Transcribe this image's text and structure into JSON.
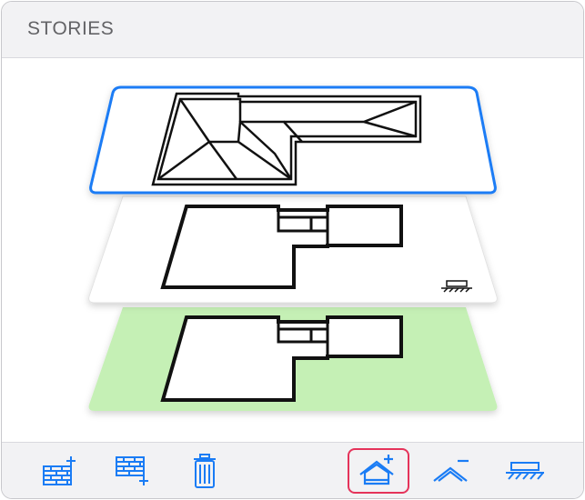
{
  "panel": {
    "title": "STORIES"
  },
  "stories": [
    {
      "name": "roof",
      "selected": true,
      "border_color": "#1a7cf5"
    },
    {
      "name": "upper-floor",
      "selected": false
    },
    {
      "name": "ground-floor",
      "selected": false,
      "fill_color": "#c5f0b5"
    }
  ],
  "toolbar": {
    "buttons": [
      {
        "name": "add-story-above-button",
        "icon": "brick-wall-plus-icon"
      },
      {
        "name": "add-story-below-button",
        "icon": "brick-wall-plus-below-icon"
      },
      {
        "name": "delete-story-button",
        "icon": "trash-icon"
      },
      {
        "name": "add-roof-button",
        "icon": "house-plus-icon",
        "active": true
      },
      {
        "name": "remove-roof-button",
        "icon": "roof-minus-icon"
      },
      {
        "name": "foundation-button",
        "icon": "ground-hatch-icon"
      }
    ],
    "icon_color": "#1a7cf5",
    "active_border_color": "#e5335a"
  }
}
